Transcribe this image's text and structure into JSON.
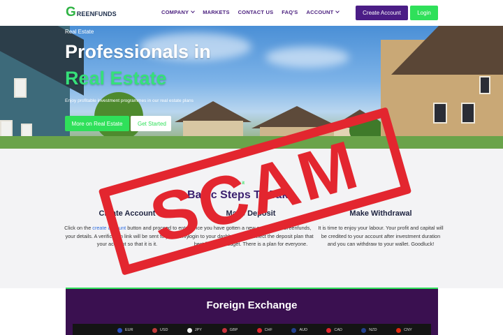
{
  "nav": {
    "logo_initial": "G",
    "logo_rest": "REENFUNDS",
    "menu": [
      {
        "label": "COMPANY",
        "dropdown": true
      },
      {
        "label": "MARKETS",
        "dropdown": false
      },
      {
        "label": "CONTACT US",
        "dropdown": false
      },
      {
        "label": "FAQ'S",
        "dropdown": false
      },
      {
        "label": "ACCOUNT",
        "dropdown": true
      }
    ],
    "create_account": "Create Account",
    "login": "Login"
  },
  "hero": {
    "tag": "Real Estate",
    "title_line1": "Professionals in",
    "title_line2": "Real Estate",
    "subtitle": "Enjoy profitable investment programmes in our real estate plans",
    "btn_more": "More on Real Estate",
    "btn_start": "Get Started"
  },
  "steps": {
    "kicker": "How it",
    "title": "Basic Steps To Take",
    "items": [
      {
        "title": "Create Account",
        "text_pre": "Click on the ",
        "link": "create account",
        "text_post": " button and proceed to enter your details. A verification link will be sent to you, verify your account so that it is it."
      },
      {
        "title": "Make Deposit",
        "text": "Once you have gotten a new account on Greenfunds, login to your dashboard and select the deposit plan that best fits your budget. There is a plan for everyone."
      },
      {
        "title": "Make Withdrawal",
        "text": "It is time to enjoy your labour. Your profit and capital will be credited to your account after investment duration and you can withdraw to your wallet. Goodluck!"
      }
    ]
  },
  "forex": {
    "title": "Foreign Exchange",
    "currencies": [
      {
        "code": "EUR",
        "color": "#2a4fbf"
      },
      {
        "code": "USD",
        "color": "#c03a3a"
      },
      {
        "code": "JPY",
        "color": "#f2f2f2"
      },
      {
        "code": "GBP",
        "color": "#c8323c"
      },
      {
        "code": "CHF",
        "color": "#e0262e"
      },
      {
        "code": "AUD",
        "color": "#23408e"
      },
      {
        "code": "CAD",
        "color": "#e0262e"
      },
      {
        "code": "NZD",
        "color": "#23408e"
      },
      {
        "code": "CNY",
        "color": "#de2910"
      }
    ]
  },
  "stamp": {
    "text": "SCAM",
    "color": "#e3262f"
  },
  "colors": {
    "brand_purple": "#4b1d86",
    "brand_green": "#2fe05a"
  }
}
